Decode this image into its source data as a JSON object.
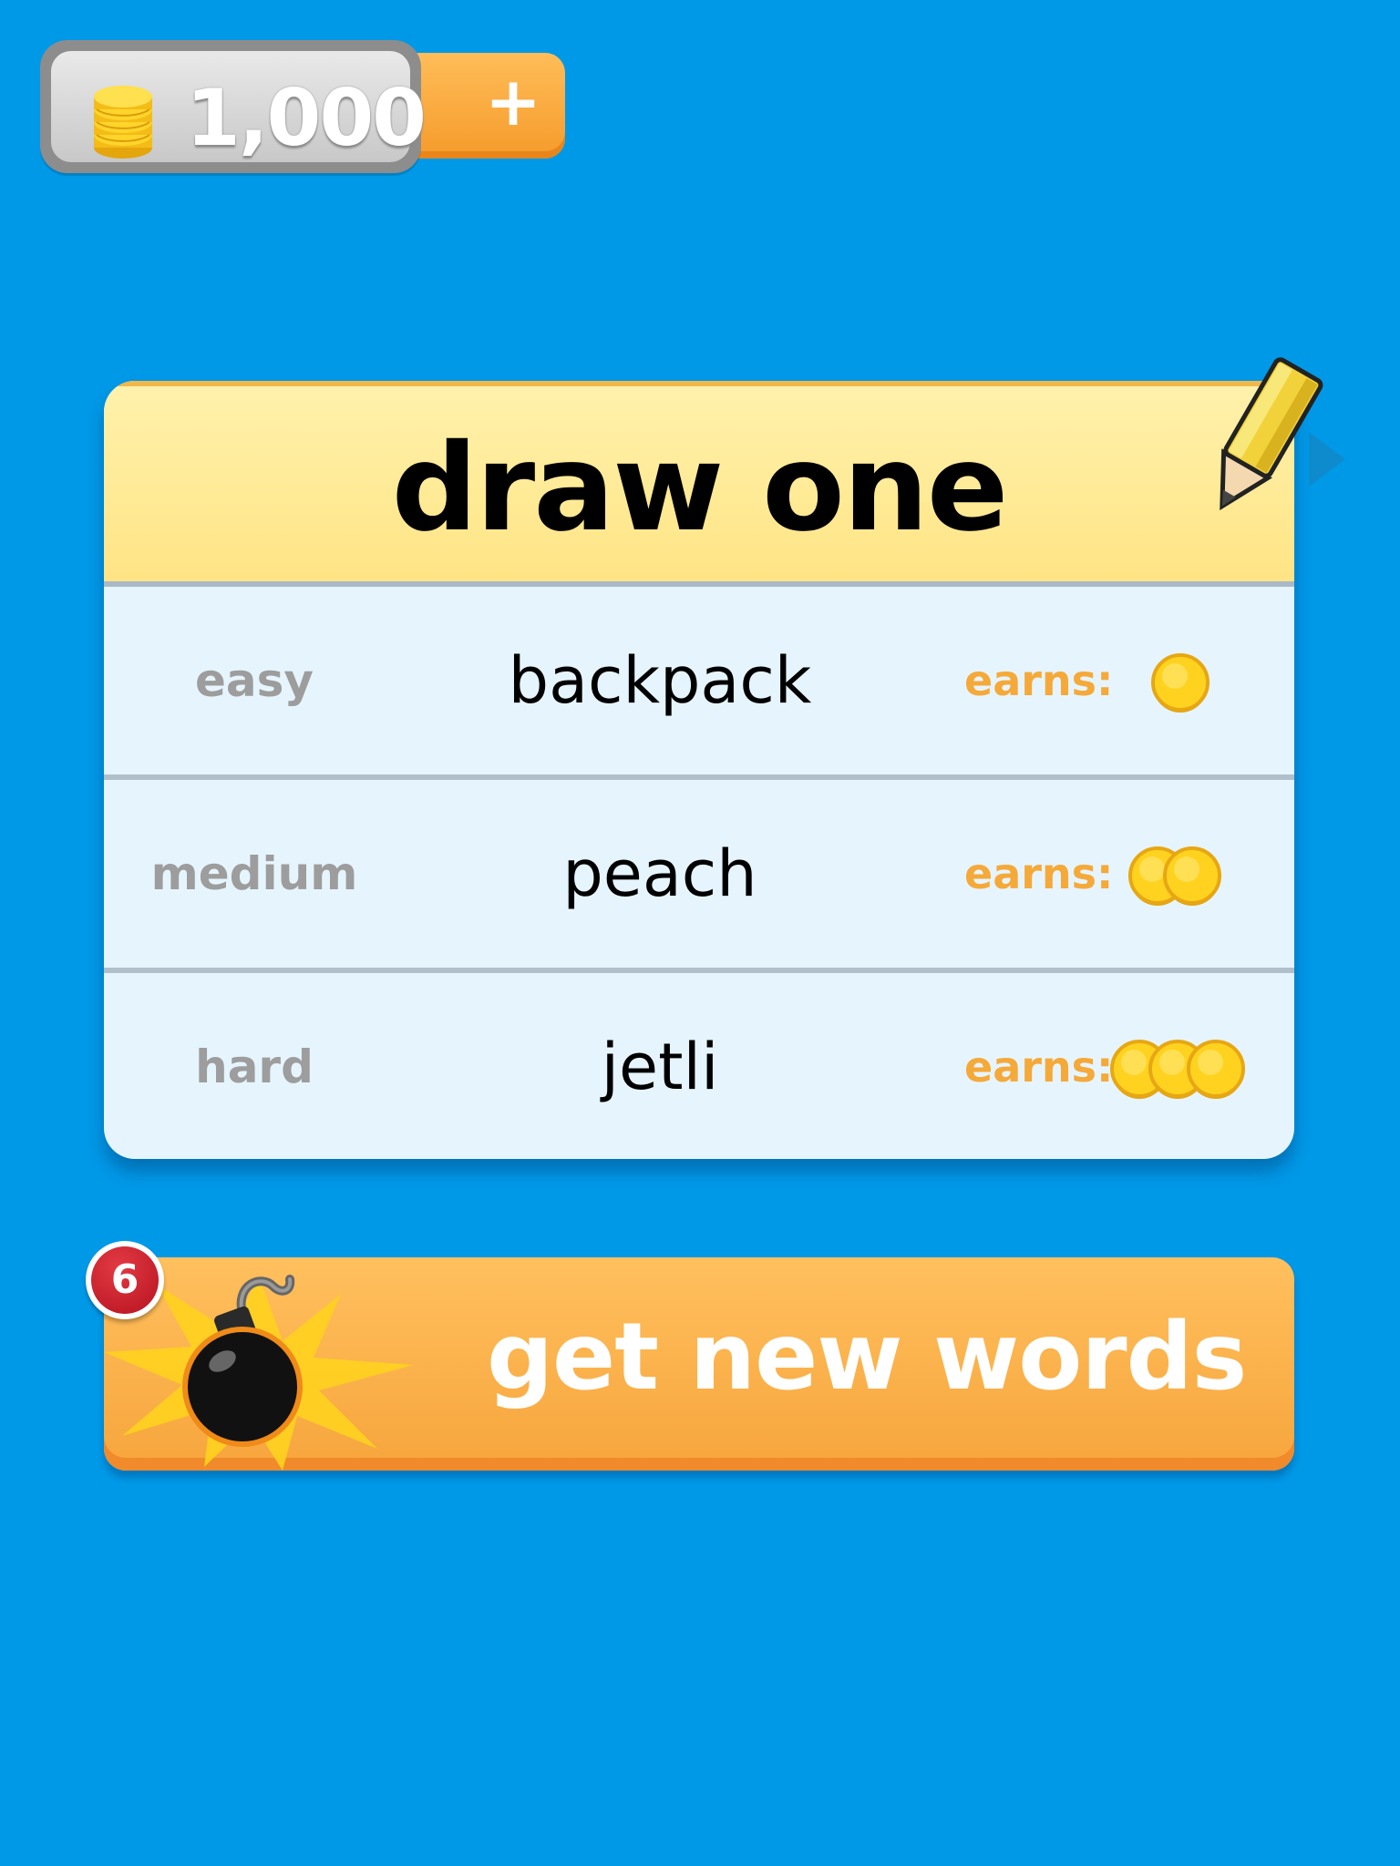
{
  "currency": {
    "amount": "1,000",
    "icon": "coin-stack-icon",
    "add_button_icon": "plus-icon"
  },
  "card": {
    "title": "draw one",
    "icon": "pencil-icon",
    "earns_label": "earns:",
    "rows": [
      {
        "difficulty": "easy",
        "word": "backpack",
        "coins": 1
      },
      {
        "difficulty": "medium",
        "word": "peach",
        "coins": 2
      },
      {
        "difficulty": "hard",
        "word": "jetli",
        "coins": 3
      }
    ]
  },
  "new_words_button": {
    "label": "get new words",
    "icon": "bomb-icon",
    "badge_count": "6"
  },
  "colors": {
    "background": "#0099e8",
    "header_yellow": "#ffe485",
    "row_background": "#e6f5fd",
    "earns_orange": "#f5a939",
    "button_orange": "#f7a53c",
    "badge_red": "#c41a26",
    "coin_gold": "#ffd21f"
  }
}
